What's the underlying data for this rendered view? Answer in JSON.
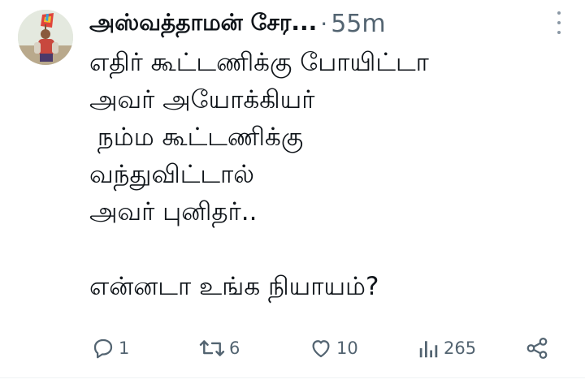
{
  "tweet": {
    "author_name": "அஸ்வத்தாமன் சேர...",
    "separator": "·",
    "time": "55m",
    "lines": [
      "எதிர் கூட்டணிக்கு போயிட்டா",
      "அவர் அயோக்கியர்",
      " நம்ம கூட்டணிக்கு",
      "வந்துவிட்டால்",
      "அவர் புனிதர்..",
      "",
      "என்னடா உங்க நியாயம்?"
    ]
  },
  "actions": {
    "reply": {
      "icon": "reply-icon",
      "count": "1"
    },
    "retweet": {
      "icon": "retweet-icon",
      "count": "6"
    },
    "like": {
      "icon": "heart-icon",
      "count": "10"
    },
    "views": {
      "icon": "analytics-icon",
      "count": "265"
    },
    "share": {
      "icon": "share-icon"
    }
  },
  "colors": {
    "text": "#0f1419",
    "muted": "#536471",
    "divider": "#eff3f4"
  }
}
